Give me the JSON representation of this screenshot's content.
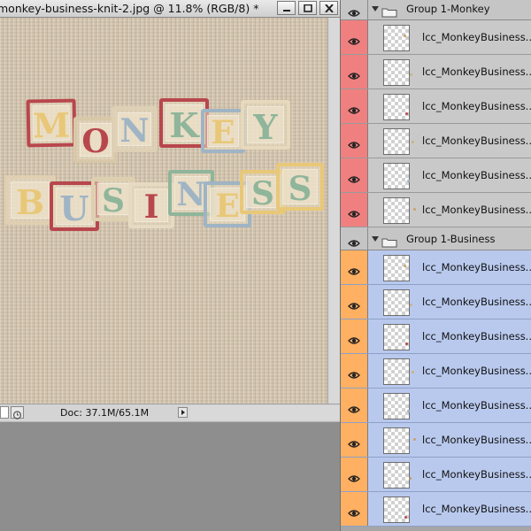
{
  "document": {
    "title": "monkey-business-knit-2.jpg @ 11.8% (RGB/8) *",
    "status": "Doc: 37.1M/65.1M",
    "colors": {
      "canvas": "#d3c4ae",
      "red_block": "#b8474d",
      "green_block": "#8fb59a",
      "yellow_block": "#e8c878",
      "blue_block": "#9fb4c4"
    }
  },
  "artwork": {
    "word1": [
      "M",
      "O",
      "N",
      "K",
      "E",
      "Y"
    ],
    "word2": [
      "B",
      "U",
      "S",
      "I",
      "N",
      "E",
      "S",
      "S"
    ]
  },
  "layers": {
    "colors": {
      "eye_red": "#f08080",
      "eye_orange": "#ffb062",
      "selected_bg": "#b9c9ee",
      "eye_icon": "#222222"
    },
    "groups": [
      {
        "name": "Group 1-Monkey",
        "eye_color": "red",
        "selected": false,
        "layers": [
          {
            "name": "lcc_MonkeyBusiness..."
          },
          {
            "name": "lcc_MonkeyBusiness..."
          },
          {
            "name": "lcc_MonkeyBusiness..."
          },
          {
            "name": "lcc_MonkeyBusiness..."
          },
          {
            "name": "lcc_MonkeyBusiness..."
          },
          {
            "name": "lcc_MonkeyBusiness..."
          }
        ]
      },
      {
        "name": "Group 1-Business",
        "eye_color": "orange",
        "selected": true,
        "layers": [
          {
            "name": "lcc_MonkeyBusiness..."
          },
          {
            "name": "lcc_MonkeyBusiness..."
          },
          {
            "name": "lcc_MonkeyBusiness..."
          },
          {
            "name": "lcc_MonkeyBusiness..."
          },
          {
            "name": "lcc_MonkeyBusiness..."
          },
          {
            "name": "lcc_MonkeyBusiness..."
          },
          {
            "name": "lcc_MonkeyBusiness..."
          },
          {
            "name": "lcc_MonkeyBusiness..."
          }
        ]
      }
    ]
  }
}
